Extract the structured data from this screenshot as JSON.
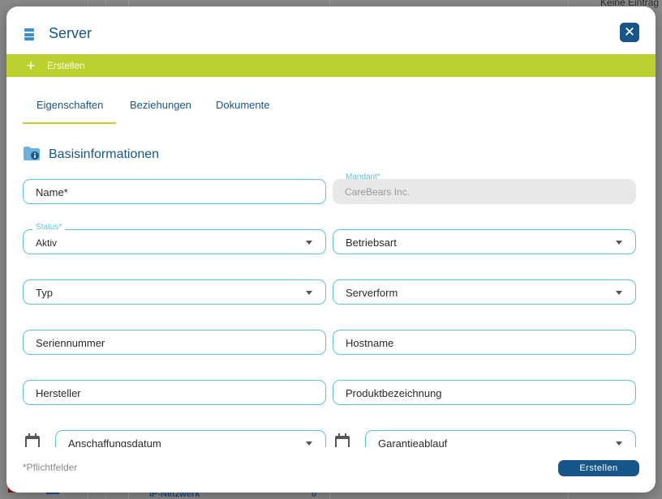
{
  "background": {
    "top_text": "Keine Eintrag",
    "bottom_label": "IP-Netzwerk",
    "bottom_count": "0"
  },
  "dialog": {
    "title": "Server",
    "icon": "server-icon",
    "close_icon": "close-icon",
    "action_bar": {
      "create_label": "Erstellen",
      "color": "#bcd02f"
    },
    "tabs": [
      "Eigenschaften",
      "Beziehungen",
      "Dokumente"
    ],
    "active_tab": "Eigenschaften",
    "section": {
      "title": "Basisinformationen",
      "icon": "folder-info-icon"
    },
    "fields": {
      "name": {
        "placeholder": "Name*"
      },
      "mandant": {
        "label": "Mandant*",
        "value": "CareBears Inc."
      },
      "status": {
        "label": "Status*",
        "value": "Aktiv"
      },
      "betriebsart": {
        "placeholder": "Betriebsart"
      },
      "typ": {
        "placeholder": "Typ"
      },
      "serverform": {
        "placeholder": "Serverform"
      },
      "seriennummer": {
        "placeholder": "Seriennummer"
      },
      "hostname": {
        "placeholder": "Hostname"
      },
      "hersteller": {
        "placeholder": "Hersteller"
      },
      "produktbezeichnung": {
        "placeholder": "Produktbezeichnung"
      },
      "anschaffungsdatum": {
        "placeholder": "Anschaffungsdatum"
      },
      "garantieablauf": {
        "placeholder": "Garantieablauf"
      }
    },
    "footer": {
      "required_note": "*Pflichtfelder",
      "submit_label": "Erstellen"
    },
    "colors": {
      "primary": "#16568a",
      "accent": "#bcd02f",
      "field_border": "#5bc4d6"
    }
  }
}
